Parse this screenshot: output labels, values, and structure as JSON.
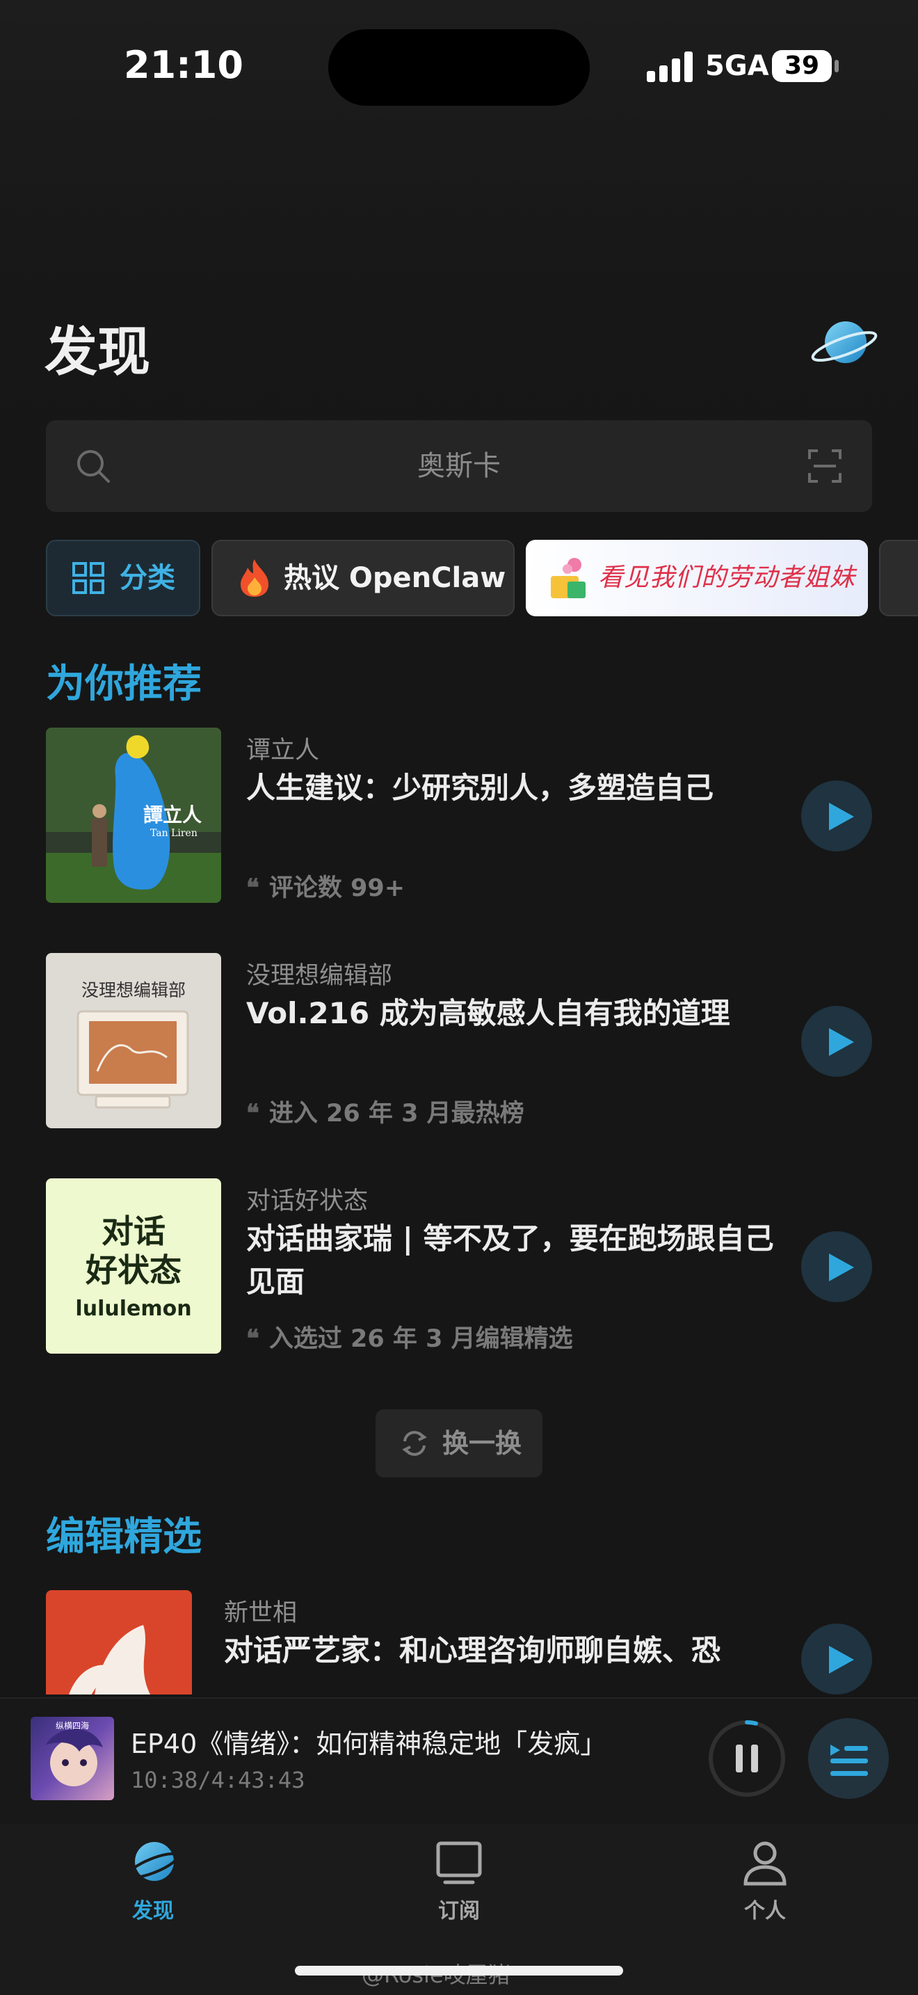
{
  "status_bar": {
    "time": "21:10",
    "network": "5GA",
    "battery": "39"
  },
  "header": {
    "title": "发现"
  },
  "search": {
    "placeholder": "奥斯卡"
  },
  "chips": [
    {
      "label": "分类"
    },
    {
      "label": "热议 OpenClaw"
    },
    {
      "label": "看见我们的劳动者姐妹"
    }
  ],
  "recommend": {
    "section_title": "为你推荐",
    "items": [
      {
        "podcast": "谭立人",
        "title": "人生建议：少研究别人，多塑造自己",
        "meta": "评论数 99+",
        "cover_text": "譚立人",
        "cover_subtext": "Tan Liren"
      },
      {
        "podcast": "没理想编辑部",
        "title": "Vol.216 成为高敏感人自有我的道理",
        "meta": "进入 26 年 3 月最热榜",
        "cover_text": "没理想编辑部"
      },
      {
        "podcast": "对话好状态",
        "title": "对话曲家瑞 | 等不及了，要在跑场跟自己见面",
        "meta": "入选过 26 年 3 月编辑精选",
        "cover_text_1": "对话",
        "cover_text_2": "好状态",
        "cover_brand": "lululemon"
      }
    ],
    "refresh_label": "换一换"
  },
  "editor": {
    "section_title": "编辑精选",
    "items": [
      {
        "podcast": "新世相",
        "title": "对话严艺家：和心理咨询师聊自嫉、恐"
      }
    ]
  },
  "player": {
    "title": "EP40《情绪》：如何精神稳定地「发疯」",
    "time": "10:38/4:43:43",
    "progress": 0.04,
    "thumb_text": "纵横四海"
  },
  "tabs": [
    {
      "label": "发现",
      "active": true
    },
    {
      "label": "订阅",
      "active": false
    },
    {
      "label": "个人",
      "active": false
    }
  ],
  "watermark": "@Rosie吱屋猪",
  "colors": {
    "accent": "#2fa7dd",
    "background": "#161616"
  }
}
